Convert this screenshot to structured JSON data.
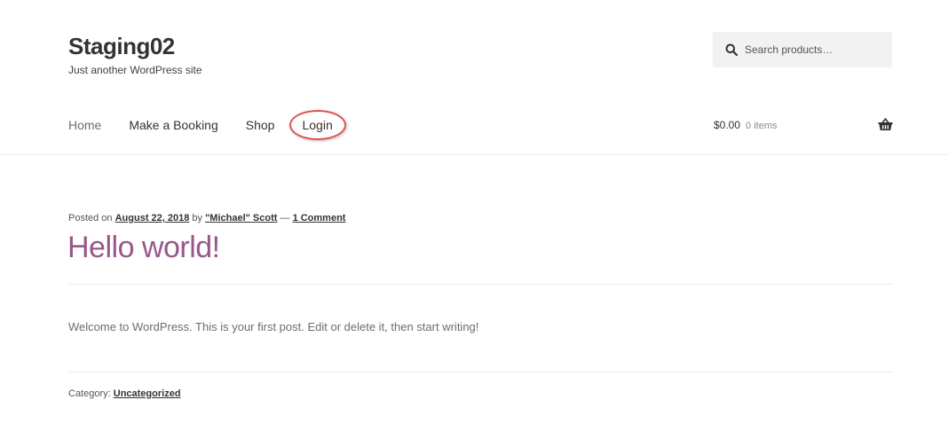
{
  "header": {
    "site_title": "Staging02",
    "tagline": "Just another WordPress site",
    "search": {
      "placeholder": "Search products…"
    }
  },
  "nav": {
    "items": [
      {
        "label": "Home"
      },
      {
        "label": "Make a Booking"
      },
      {
        "label": "Shop"
      },
      {
        "label": "Login"
      }
    ]
  },
  "cart": {
    "total": "$0.00",
    "count": "0 items",
    "icon": "basket-icon"
  },
  "post": {
    "meta_prefix": "Posted on ",
    "date": "August 22, 2018",
    "by": " by ",
    "author": "\"Michael\" Scott",
    "dash": " — ",
    "comments": "1 Comment",
    "title": "Hello world!",
    "body": "Welcome to WordPress. This is your first post. Edit or delete it, then start writing!",
    "category_label": "Category: ",
    "category": "Uncategorized"
  },
  "colors": {
    "title_accent": "#96588a",
    "highlight": "#e05252"
  }
}
